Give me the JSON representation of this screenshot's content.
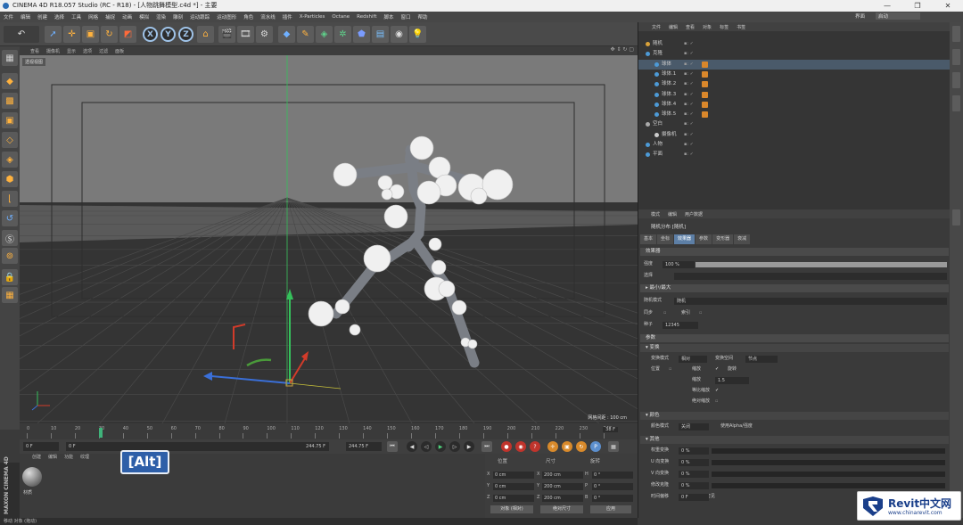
{
  "window": {
    "title": "CINEMA 4D R18.057 Studio (RC - R18) - [人物跳舞模型.c4d *] - 主要"
  },
  "menubar": {
    "items": [
      "文件",
      "编辑",
      "创建",
      "选择",
      "工具",
      "网格",
      "捕捉",
      "动画",
      "模拟",
      "渲染",
      "雕刻",
      "运动跟踪",
      "运动图形",
      "角色",
      "流水线",
      "插件",
      "X-Particles",
      "Octane",
      "Redshift",
      "脚本",
      "窗口",
      "帮助"
    ],
    "layout_label": "界面",
    "layout_value": "启动"
  },
  "toolbar": {
    "axis_x": "X",
    "axis_y": "Y",
    "axis_z": "Z"
  },
  "viewport": {
    "menu": [
      "查看",
      "摄像机",
      "显示",
      "选项",
      "过滤",
      "面板"
    ],
    "label": "透视视图",
    "grid_label": "网格间距 : 100 cm",
    "colors": {
      "x_axis": "#d23b2a",
      "y_axis": "#35c15b",
      "z_axis": "#3a6fd8",
      "sphere": "#f0f0f0",
      "figure": "#7a7e85"
    }
  },
  "timeline": {
    "ticks": [
      "0",
      "10",
      "20",
      "30",
      "40",
      "50",
      "60",
      "70",
      "80",
      "90",
      "100",
      "110",
      "120",
      "130",
      "140",
      "150",
      "160",
      "170",
      "180",
      "190",
      "200",
      "210",
      "220",
      "230",
      "240"
    ],
    "end_frame": "38 F",
    "current": 30,
    "max": 245
  },
  "transport": {
    "start": "0 F",
    "current_field": "0 F",
    "range_end": "244.75 F",
    "end_field": "244.75 F"
  },
  "material": {
    "menu": [
      "创建",
      "编辑",
      "功能",
      "纹理"
    ],
    "item_name": "材质",
    "overlay": "[Alt]"
  },
  "brand": "MAXON CINEMA 4D",
  "coords": {
    "headers": [
      "位置",
      "尺寸",
      "旋转"
    ],
    "rows": [
      {
        "axis": "X",
        "pos": "0 cm",
        "size_axis": "X",
        "size": "200 cm",
        "rot_axis": "H",
        "rot": "0 °"
      },
      {
        "axis": "Y",
        "pos": "0 cm",
        "size_axis": "Y",
        "size": "200 cm",
        "rot_axis": "P",
        "rot": "0 °"
      },
      {
        "axis": "Z",
        "pos": "0 cm",
        "size_axis": "Z",
        "size": "200 cm",
        "rot_axis": "B",
        "rot": "0 °"
      }
    ],
    "mode1": "对象 (相对)",
    "mode2": "绝对尺寸",
    "apply": "应用"
  },
  "statusbar": {
    "text": "移动 对象 (拖动)"
  },
  "objects": {
    "menu": [
      "文件",
      "编辑",
      "查看",
      "对象",
      "标签",
      "书签"
    ],
    "items": [
      {
        "name": "随机",
        "indent": 0,
        "color": "#d9a23a"
      },
      {
        "name": "克隆",
        "indent": 0,
        "color": "#4d9ad6"
      },
      {
        "name": "球体",
        "indent": 1,
        "color": "#4d9ad6",
        "selected": true
      },
      {
        "name": "球体.1",
        "indent": 1,
        "color": "#4d9ad6"
      },
      {
        "name": "球体.2",
        "indent": 1,
        "color": "#4d9ad6"
      },
      {
        "name": "球体.3",
        "indent": 1,
        "color": "#4d9ad6"
      },
      {
        "name": "球体.4",
        "indent": 1,
        "color": "#4d9ad6"
      },
      {
        "name": "球体.5",
        "indent": 1,
        "color": "#4d9ad6"
      },
      {
        "name": "空白",
        "indent": 0,
        "color": "#aaaaaa"
      },
      {
        "name": "摄像机",
        "indent": 1,
        "color": "#cccccc"
      },
      {
        "name": "人物",
        "indent": 0,
        "color": "#4d9ad6"
      },
      {
        "name": "平面",
        "indent": 0,
        "color": "#4d9ad6"
      }
    ]
  },
  "attributes": {
    "menu": [
      "模式",
      "编辑",
      "用户数据"
    ],
    "title": "随机分布 [随机]",
    "tabs": [
      "基本",
      "坐标",
      "效果器",
      "参数",
      "变形器",
      "衰减"
    ],
    "active_tab": "效果器",
    "section_effector": "效果器",
    "strength_label": "强度",
    "strength_value": "100 %",
    "strength_fraction": 1.0,
    "selection_label": "选择",
    "minmax_label": "▸ 最小/最大",
    "random_mode_label": "随机模式",
    "random_mode_value": "随机",
    "sync_label": "同步",
    "index_label": "索引",
    "seed_label": "种子",
    "seed_value": "12345",
    "section_params": "参数",
    "sub_transform": "▾ 变换",
    "transform_mode_label": "变换模式",
    "transform_mode_value": "相对",
    "transform_space_label": "变换空间",
    "transform_space_value": "节点",
    "position_label": "位置",
    "scale_label": "缩放",
    "rotation_label": "旋转",
    "scale_value_label": "缩放",
    "scale_value": "1.5",
    "uniform_scale_label": "等比缩放",
    "absolute_scale_label": "绝对缩放",
    "sub_color": "▾ 颜色",
    "color_mode_label": "颜色模式",
    "color_mode_value": "关闭",
    "use_alpha_label": "使用Alpha/强度",
    "sub_other": "▾ 其他",
    "other_rows": [
      {
        "label": "权重变换",
        "value": "0 %"
      },
      {
        "label": "U 向变换",
        "value": "0 %"
      },
      {
        "label": "V 向变换",
        "value": "0 %"
      },
      {
        "label": "修改克隆",
        "value": "0 %"
      },
      {
        "label": "时间偏移",
        "value": "0 F"
      }
    ],
    "visible_label": "可见"
  },
  "watermark": {
    "title": "Revit中文网",
    "url": "www.chinarevit.com"
  }
}
